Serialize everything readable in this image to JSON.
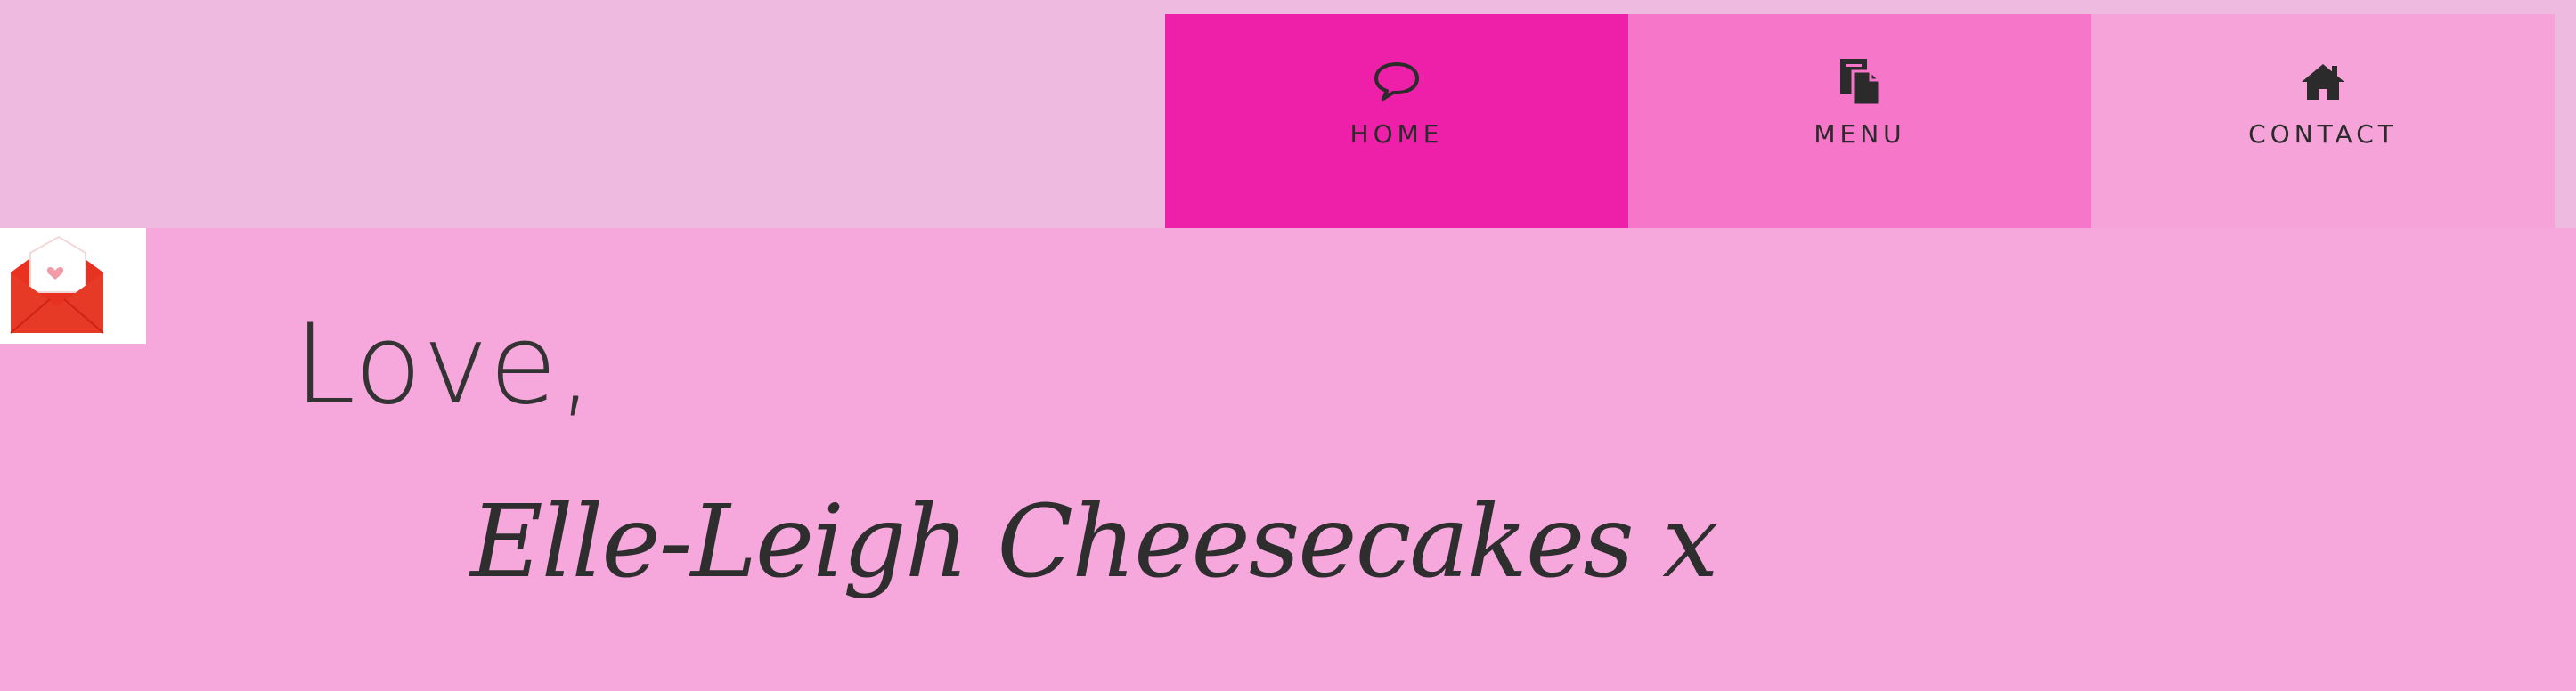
{
  "nav": {
    "items": [
      {
        "label": "HOME",
        "icon": "speech-bubble-icon",
        "color": "#ee1fa8"
      },
      {
        "label": "MENU",
        "icon": "documents-icon",
        "color": "#f676c9"
      },
      {
        "label": "CONTACT",
        "icon": "house-icon",
        "color": "#f5a3d8"
      }
    ]
  },
  "content": {
    "greeting": "Love,",
    "signature": "Elle-Leigh Cheesecakes x",
    "envelope_icon": "love-letter-envelope-icon"
  },
  "colors": {
    "header_bg": "#efbadf",
    "page_bg": "#f6a8dd",
    "text": "#2e2e2e"
  }
}
